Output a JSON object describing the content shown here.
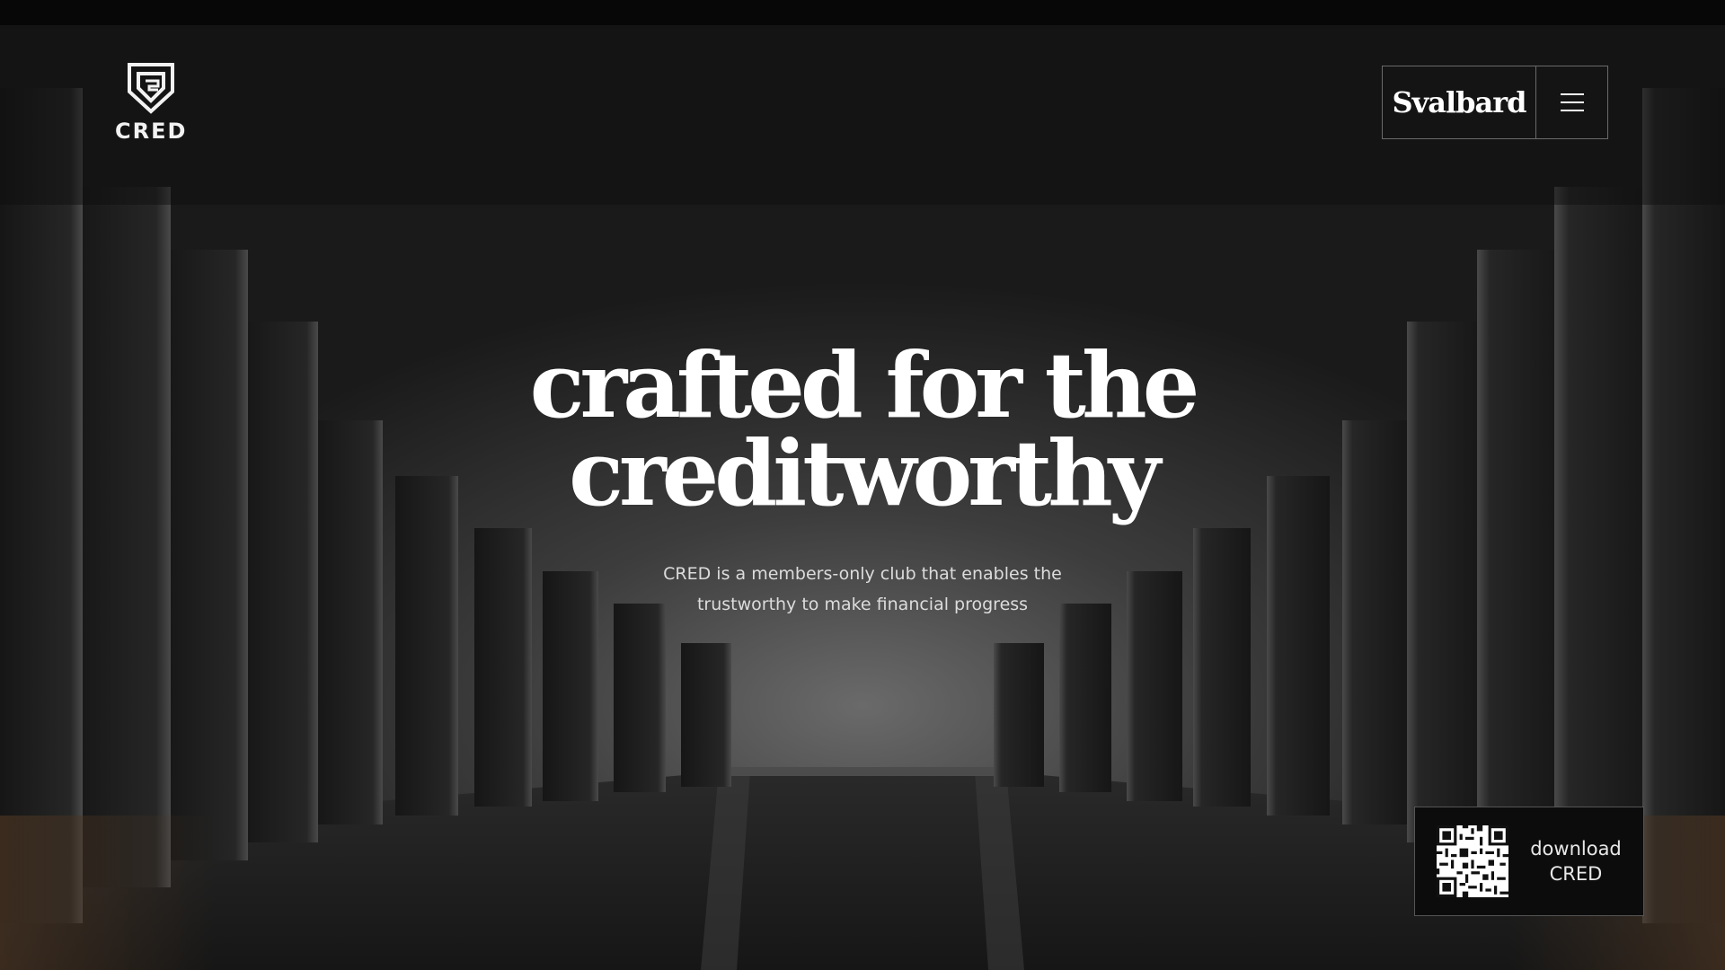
{
  "brand": {
    "logo_text": "CRED"
  },
  "nav": {
    "brand_label": "Svalbard",
    "menu_icon": "hamburger-menu-icon"
  },
  "hero": {
    "headline_line1": "crafted for the",
    "headline_line2": "creditworthy",
    "subtitle_line1": "CRED is a members-only club that enables the",
    "subtitle_line2": "trustworthy to make financial progress"
  },
  "download": {
    "label_line1": "download",
    "label_line2": "CRED",
    "qr_icon": "qr-code-icon"
  },
  "colors": {
    "background": "#111111",
    "text": "#ffffff",
    "muted_text": "#dcdcdc",
    "border": "#6a6a6a"
  }
}
